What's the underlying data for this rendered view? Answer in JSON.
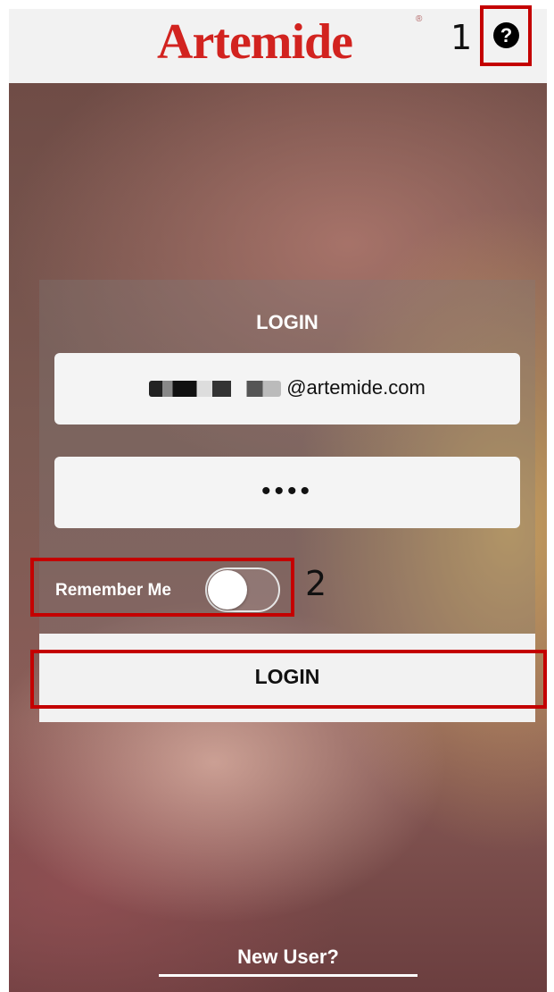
{
  "header": {
    "logo_text": "Artemide",
    "registered_mark": "®",
    "help_icon": "question-circle-icon",
    "help_symbol": "?"
  },
  "annotations": {
    "marker_1": "1",
    "marker_2": "2",
    "highlight_color": "#c40000"
  },
  "login_form": {
    "title": "LOGIN",
    "email_value": "@artemide.com",
    "password_value": "••••",
    "remember_label": "Remember Me",
    "remember_on": false,
    "submit_label": "LOGIN"
  },
  "footer": {
    "new_user_label": "New User?"
  },
  "colors": {
    "brand_red": "#d2231f",
    "header_bg": "#f2f2f2"
  }
}
